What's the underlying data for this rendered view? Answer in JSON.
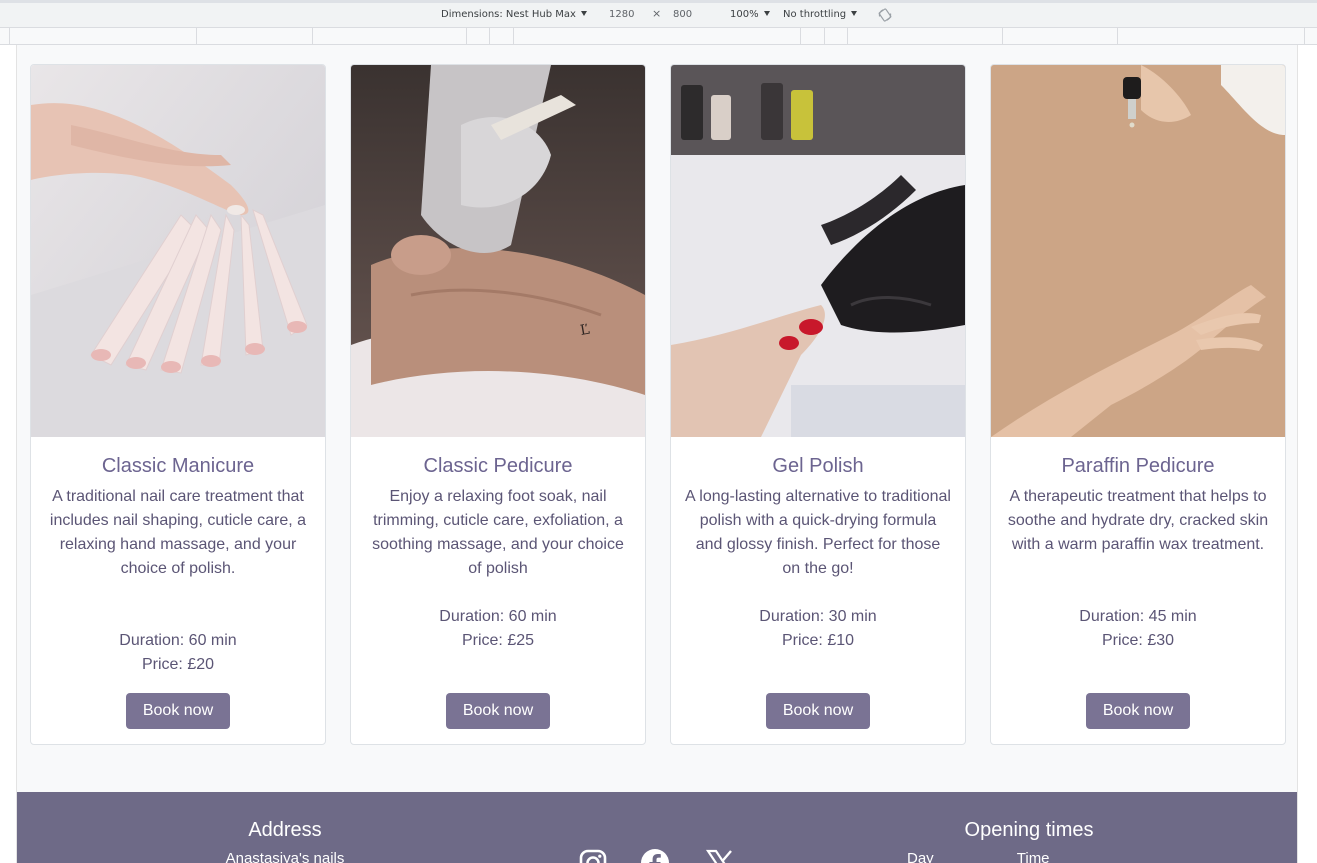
{
  "devtools": {
    "dimensions_label": "Dimensions: Nest Hub Max",
    "width": "1280",
    "times": "×",
    "height": "800",
    "zoom": "100%",
    "throttling": "No throttling",
    "rotate_icon": "rotate-icon"
  },
  "services": [
    {
      "title": "Classic Manicure",
      "description": "A traditional nail care treatment that includes nail shaping, cuticle care, a relaxing hand massage, and your choice of polish.",
      "duration": "Duration: 60 min",
      "price": "Price: £20",
      "button": "Book now"
    },
    {
      "title": "Classic Pedicure",
      "description": "Enjoy a relaxing foot soak, nail trimming, cuticle care, exfoliation, a soothing massage, and your choice of polish",
      "duration": "Duration: 60 min",
      "price": "Price: £25",
      "button": "Book now"
    },
    {
      "title": "Gel Polish",
      "description": "A long-lasting alternative to traditional polish with a quick-drying formula and glossy finish. Perfect for those on the go!",
      "duration": "Duration: 30 min",
      "price": "Price: £10",
      "button": "Book now"
    },
    {
      "title": "Paraffin Pedicure",
      "description": "A therapeutic treatment that helps to soothe and hydrate dry, cracked skin with a warm paraffin wax treatment.",
      "duration": "Duration: 45 min",
      "price": "Price: £30",
      "button": "Book now"
    }
  ],
  "footer": {
    "address_title": "Address",
    "address_line": "Anastasiya's nails",
    "opening_title": "Opening times",
    "opening_line": "Day                    Time",
    "social_icons": [
      "instagram-icon",
      "facebook-icon",
      "x-icon"
    ]
  },
  "colors": {
    "accent": "#7a7394",
    "title": "#6c6490",
    "text": "#5b5575",
    "footer_bg": "#6e6a87",
    "page_bg": "#f8f9fa"
  }
}
